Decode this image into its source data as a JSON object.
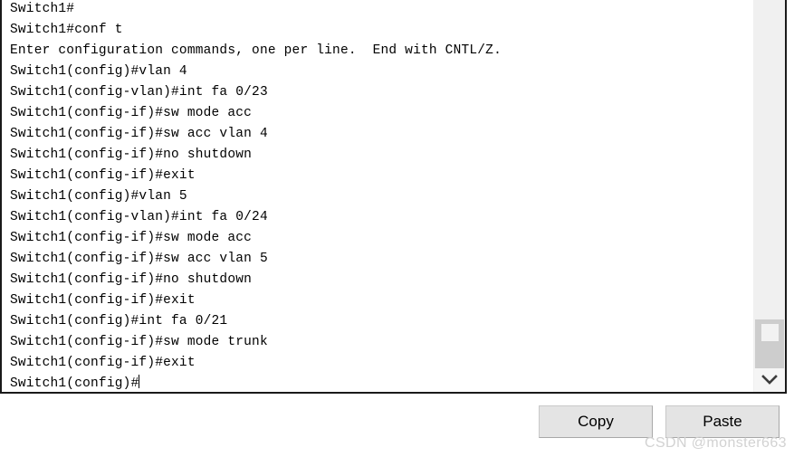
{
  "terminal": {
    "lines": [
      "Switch1#",
      "Switch1#conf t",
      "Enter configuration commands, one per line.  End with CNTL/Z.",
      "Switch1(config)#vlan 4",
      "Switch1(config-vlan)#int fa 0/23",
      "Switch1(config-if)#sw mode acc",
      "Switch1(config-if)#sw acc vlan 4",
      "Switch1(config-if)#no shutdown",
      "Switch1(config-if)#exit",
      "Switch1(config)#vlan 5",
      "Switch1(config-vlan)#int fa 0/24",
      "Switch1(config-if)#sw mode acc",
      "Switch1(config-if)#sw acc vlan 5",
      "Switch1(config-if)#no shutdown",
      "Switch1(config-if)#exit",
      "Switch1(config)#int fa 0/21",
      "Switch1(config-if)#sw mode trunk",
      "Switch1(config-if)#exit"
    ],
    "prompt_line": "Switch1(config)#",
    "text_color": "#000000",
    "background_color": "#ffffff"
  },
  "scrollbar": {
    "down_arrow_icon": "chevron-down-icon",
    "track_color": "#f0f0f0",
    "thumb_color": "#cdcdcd"
  },
  "actions": {
    "copy_label": "Copy",
    "paste_label": "Paste",
    "button_face_color": "#e4e4e4"
  },
  "watermark": {
    "text": "CSDN @monster663",
    "color": "#d2d2d2"
  }
}
